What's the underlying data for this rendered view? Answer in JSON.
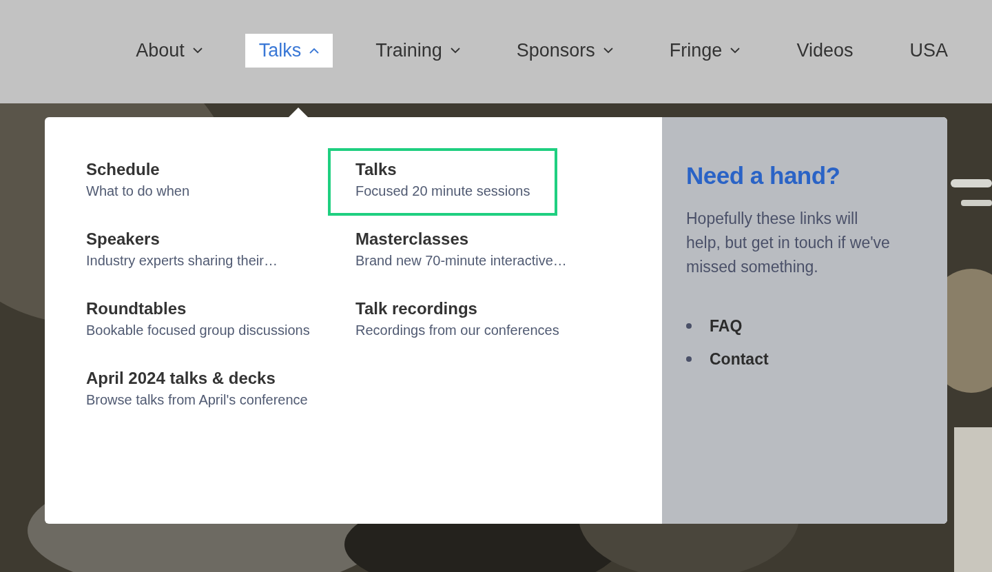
{
  "nav": [
    {
      "label": "About",
      "kind": "dropdown",
      "expanded": false,
      "selected": false
    },
    {
      "label": "Talks",
      "kind": "dropdown",
      "expanded": true,
      "selected": true
    },
    {
      "label": "Training",
      "kind": "dropdown",
      "expanded": false,
      "selected": false
    },
    {
      "label": "Sponsors",
      "kind": "dropdown",
      "expanded": false,
      "selected": false
    },
    {
      "label": "Fringe",
      "kind": "dropdown",
      "expanded": false,
      "selected": false
    },
    {
      "label": "Videos",
      "kind": "link",
      "selected": false
    },
    {
      "label": "USA",
      "kind": "link",
      "selected": false
    }
  ],
  "menu": {
    "items": [
      {
        "title": "Schedule",
        "description": "What to do when",
        "selected": false
      },
      {
        "title": "Talks",
        "description": "Focused 20 minute sessions",
        "selected": true
      },
      {
        "title": "Speakers",
        "description": "Industry experts sharing their…",
        "selected": false
      },
      {
        "title": "Masterclasses",
        "description": "Brand new 70-minute interactive…",
        "selected": false
      },
      {
        "title": "Roundtables",
        "description": "Bookable focused group discussions",
        "selected": false
      },
      {
        "title": "Talk recordings",
        "description": "Recordings from our conferences",
        "selected": false
      },
      {
        "title": "April 2024 talks & decks",
        "description": "Browse talks from April's conference",
        "selected": false
      }
    ],
    "help": {
      "heading": "Need a hand?",
      "text": "Hopefully these links will help, but get in touch if we've missed something.",
      "links": [
        "FAQ",
        "Contact"
      ]
    }
  }
}
